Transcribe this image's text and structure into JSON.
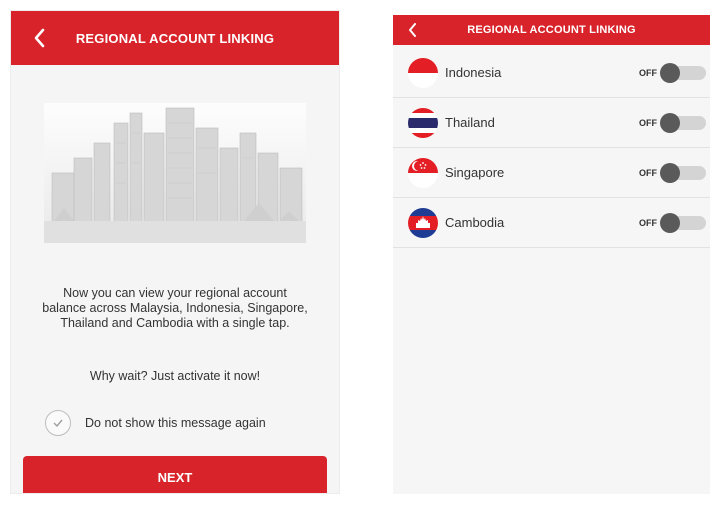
{
  "left_screen": {
    "title": "REGIONAL ACCOUNT LINKING",
    "message_paragraph": "Now you can view your regional account balance across Malaysia, Indonesia, Singapore, Thailand and Cambodia with a single tap.",
    "message_cta": "Why wait? Just activate it now!",
    "checkbox_label": "Do not show this message again",
    "checkbox_checked": false,
    "next_button": "NEXT"
  },
  "right_screen": {
    "title": "REGIONAL ACCOUNT LINKING",
    "countries": [
      {
        "name": "Indonesia",
        "toggle": "OFF",
        "flag_icon": "indonesia-flag-icon"
      },
      {
        "name": "Thailand",
        "toggle": "OFF",
        "flag_icon": "thailand-flag-icon"
      },
      {
        "name": "Singapore",
        "toggle": "OFF",
        "flag_icon": "singapore-flag-icon"
      },
      {
        "name": "Cambodia",
        "toggle": "OFF",
        "flag_icon": "cambodia-flag-icon"
      }
    ]
  },
  "colors": {
    "brand_red": "#d8232a",
    "toggle_off_track": "#d4d4d4",
    "toggle_off_knob": "#5a5a5a"
  }
}
